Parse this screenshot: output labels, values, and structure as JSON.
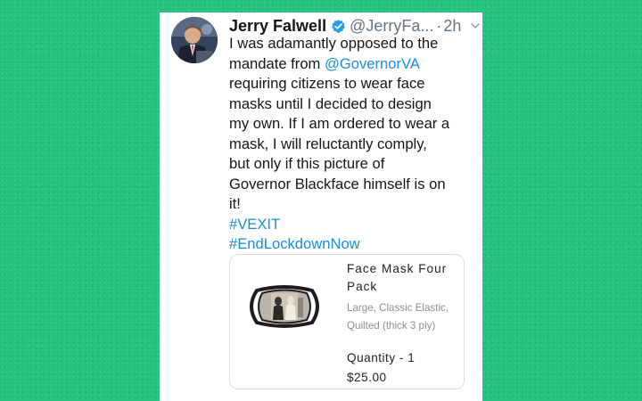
{
  "background_color": "#1fc07a",
  "tweet": {
    "author_name": "Jerry Falwell",
    "handle": "@JerryFa...",
    "separator": "·",
    "timestamp": "2h",
    "verified_icon": "verified-badge-icon",
    "menu_icon": "chevron-down-icon",
    "avatar_icon": "profile-photo",
    "accent_color": "#1b8ed9",
    "body": {
      "line1": "I was adamantly opposed to the",
      "line2_prefix": "mandate from ",
      "mention": "@GovernorVA",
      "line3": "requiring citizens to wear face",
      "line4": "masks until I decided to design",
      "line5": "my own. If I am ordered to wear a",
      "line6": "mask, I will reluctantly comply,",
      "line7": "but only if this picture of",
      "line8": "Governor Blackface himself is on",
      "line9": "it!",
      "hashtag1": "#VEXIT",
      "hashtag2": "#EndLockdownNow"
    },
    "product": {
      "title_line1": "Face Mask Four",
      "title_line2": "Pack",
      "desc_line1": "Large, Classic Elastic,",
      "desc_line2": "Quilted (thick 3 ply)",
      "quantity": "Quantity - 1",
      "price": "$25.00",
      "image_icon": "face-mask-image"
    }
  }
}
